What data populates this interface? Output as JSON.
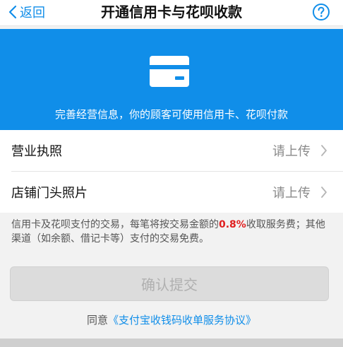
{
  "nav": {
    "back_label": "返回",
    "title": "开通信用卡与花呗收款",
    "help_icon": "question-circle-icon"
  },
  "banner": {
    "icon": "credit-card-icon",
    "text": "完善经营信息，你的顾客可使用信用卡、花呗付款"
  },
  "items": [
    {
      "label": "营业执照",
      "value": "请上传"
    },
    {
      "label": "店铺门头照片",
      "value": "请上传"
    }
  ],
  "notice": {
    "before": "信用卡及花呗支付的交易，每笔将按交易金额的",
    "rate": "0.8%",
    "after": "收取服务费；其他渠道（如余额、借记卡等）支付的交易免费。"
  },
  "submit_label": "确认提交",
  "agreement": {
    "prefix": "同意",
    "link": "《支付宝收钱码收单服务协议》"
  },
  "colors": {
    "accent": "#108ee9",
    "rate": "#e02020",
    "disabled_bg": "#dcdcdc"
  }
}
